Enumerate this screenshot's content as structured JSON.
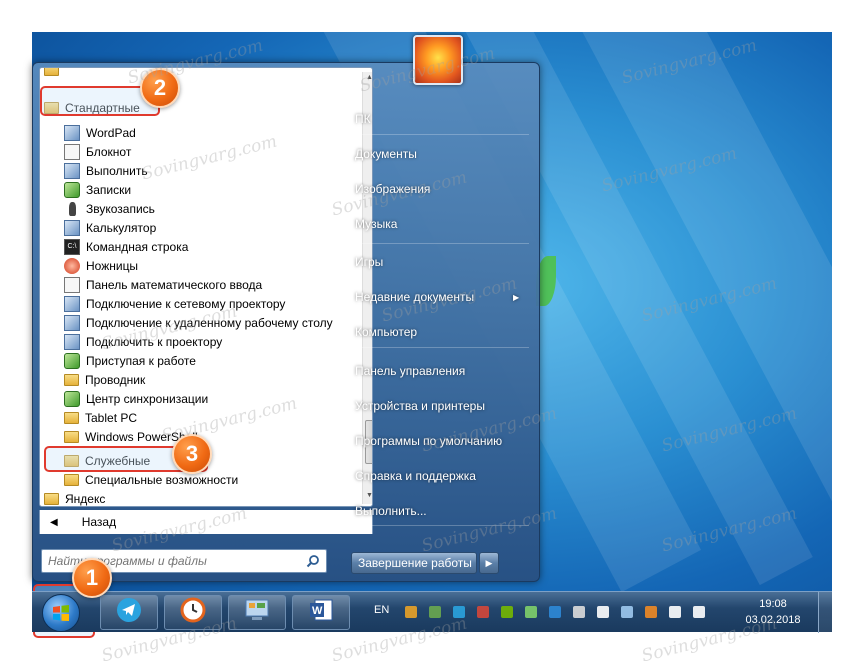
{
  "start_menu": {
    "programs": [
      {
        "label": "Стандартные",
        "icon": "folder-icon",
        "name": "program-standard",
        "highlighted": true
      },
      {
        "label": "WordPad",
        "icon": "wordpad-icon",
        "name": "program-wordpad"
      },
      {
        "label": "Блокнот",
        "icon": "notepad-icon",
        "name": "program-notepad"
      },
      {
        "label": "Выполнить",
        "icon": "run-icon",
        "name": "program-run"
      },
      {
        "label": "Записки",
        "icon": "sticky-notes-icon",
        "name": "program-sticky-notes"
      },
      {
        "label": "Звукозапись",
        "icon": "microphone-icon",
        "name": "program-sound-recorder"
      },
      {
        "label": "Калькулятор",
        "icon": "calculator-icon",
        "name": "program-calculator"
      },
      {
        "label": "Командная строка",
        "icon": "cmd-icon",
        "name": "program-cmd"
      },
      {
        "label": "Ножницы",
        "icon": "scissors-icon",
        "name": "program-snipping"
      },
      {
        "label": "Панель математического ввода",
        "icon": "math-panel-icon",
        "name": "program-math-input"
      },
      {
        "label": "Подключение к сетевому проектору",
        "icon": "network-projector-icon",
        "name": "program-net-projector"
      },
      {
        "label": "Подключение к удаленному рабочему столу",
        "icon": "remote-desktop-icon",
        "name": "program-remote-desktop"
      },
      {
        "label": "Подключить к проектору",
        "icon": "projector-icon",
        "name": "program-projector"
      },
      {
        "label": "Приступая к работе",
        "icon": "getting-started-icon",
        "name": "program-getting-started"
      },
      {
        "label": "Проводник",
        "icon": "explorer-icon",
        "name": "program-explorer"
      },
      {
        "label": "Центр синхронизации",
        "icon": "sync-center-icon",
        "name": "program-sync-center"
      },
      {
        "label": "Tablet PC",
        "icon": "folder-icon",
        "name": "program-tablet-pc"
      },
      {
        "label": "Windows PowerShell",
        "icon": "folder-icon",
        "name": "program-powershell"
      },
      {
        "label": "Служебные",
        "icon": "folder-icon",
        "name": "program-system-tools",
        "highlighted": true
      },
      {
        "label": "Специальные возможности",
        "icon": "folder-icon",
        "name": "program-accessibility"
      },
      {
        "label": "Яндекс",
        "icon": "folder-icon",
        "name": "program-yandex"
      }
    ],
    "back_label": "Назад",
    "search_placeholder": "Найти программы и файлы",
    "right_items": [
      {
        "label": "ПК",
        "name": "right-item-pc"
      },
      {
        "label": "Документы",
        "name": "right-item-documents"
      },
      {
        "label": "Изображения",
        "name": "right-item-pictures"
      },
      {
        "label": "Музыка",
        "name": "right-item-music"
      },
      {
        "label": "Игры",
        "name": "right-item-games"
      },
      {
        "label": "Недавние документы",
        "name": "right-item-recent",
        "submenu": true
      },
      {
        "label": "Компьютер",
        "name": "right-item-computer"
      },
      {
        "label": "Панель управления",
        "name": "right-item-control-panel"
      },
      {
        "label": "Устройства и принтеры",
        "name": "right-item-devices"
      },
      {
        "label": "Программы по умолчанию",
        "name": "right-item-default-programs"
      },
      {
        "label": "Справка и поддержка",
        "name": "right-item-help"
      },
      {
        "label": "Выполнить...",
        "name": "right-item-run"
      }
    ],
    "shutdown_label": "Завершение работы"
  },
  "steps": [
    "1",
    "2",
    "3"
  ],
  "taskbar": {
    "apps": [
      {
        "icon": "telegram-icon",
        "name": "taskbar-telegram"
      },
      {
        "icon": "clock-app-icon",
        "name": "taskbar-clock-app"
      },
      {
        "icon": "control-panel-icon",
        "name": "taskbar-control-panel"
      },
      {
        "icon": "word-icon",
        "name": "taskbar-word"
      }
    ],
    "language": "EN",
    "time": "19:08",
    "date": "03.02.2018"
  },
  "watermark": "Sovingvarg.com",
  "colors": {
    "highlight_box": "#e03a2e",
    "step_badge": "#f06a14",
    "taskbar": "#23466d"
  }
}
